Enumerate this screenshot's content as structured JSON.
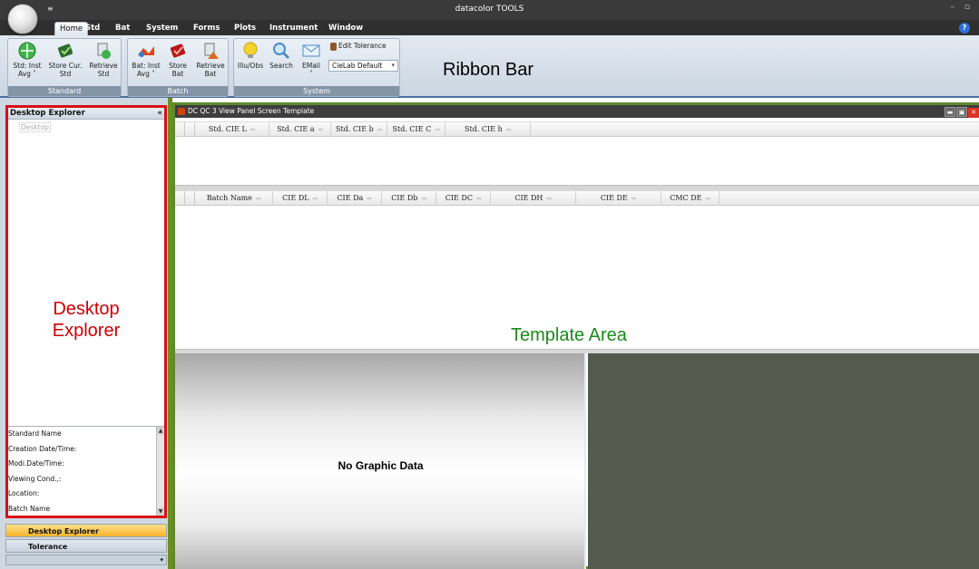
{
  "app": {
    "title": "datacolor TOOLS",
    "quick_access": "≡",
    "window_controls": "– ▫",
    "help": "?"
  },
  "tabs": [
    "Home",
    "Std",
    "Bat",
    "System",
    "Forms",
    "Plots",
    "Instrument",
    "Window"
  ],
  "ribbon": {
    "annotation": "Ribbon Bar",
    "standard": {
      "label": "Standard",
      "buttons": [
        "Std: Inst\nAvg ˅",
        "Store Cur.\nStd",
        "Retrieve\nStd"
      ]
    },
    "batch": {
      "label": "Batch",
      "buttons": [
        "Bat: Inst\nAvg ˅",
        "Store\nBat",
        "Retrieve\nBat"
      ]
    },
    "system": {
      "label": "System",
      "buttons": [
        "Illu/Obs",
        "Search",
        "EMail\n˅"
      ],
      "edit_tolerance": "Edit Tolerance",
      "tolerance_select": "CieLab Default"
    }
  },
  "left_panel": {
    "header": "Desktop Explorer",
    "collapse": "«",
    "tree_root": "Desktop",
    "annotation": "Desktop\nExplorer",
    "properties": [
      "Standard Name",
      "Creation Date/Time:",
      "Modi.Date/Time:",
      "Viewing Cond.,:",
      "Location:",
      "Batch Name"
    ],
    "nav_active": "Desktop Explorer",
    "nav_inactive": "Tolerance",
    "nav_more": "▾"
  },
  "template": {
    "title": "DC QC 3 View Panel Screen Template",
    "annotation": "Template Area",
    "std_columns": [
      "Std. CIE L",
      "Std. CIE a",
      "Std. CIE b",
      "Std. CIE C",
      "Std. CIE h"
    ],
    "batch_columns": [
      "Batch Name",
      "CIE DL",
      "CIE Da",
      "CIE Db",
      "CIE DC",
      "CIE DH",
      "CIE DE",
      "CMC DE"
    ],
    "pin_glyph": "⫤",
    "no_graphic": "No Graphic Data"
  },
  "colors": {
    "explorer_border": "#d90f17",
    "template_border": "#5e8a2d",
    "template_annotation": "#1a8a1a",
    "active_nav": "#f7b32b"
  }
}
